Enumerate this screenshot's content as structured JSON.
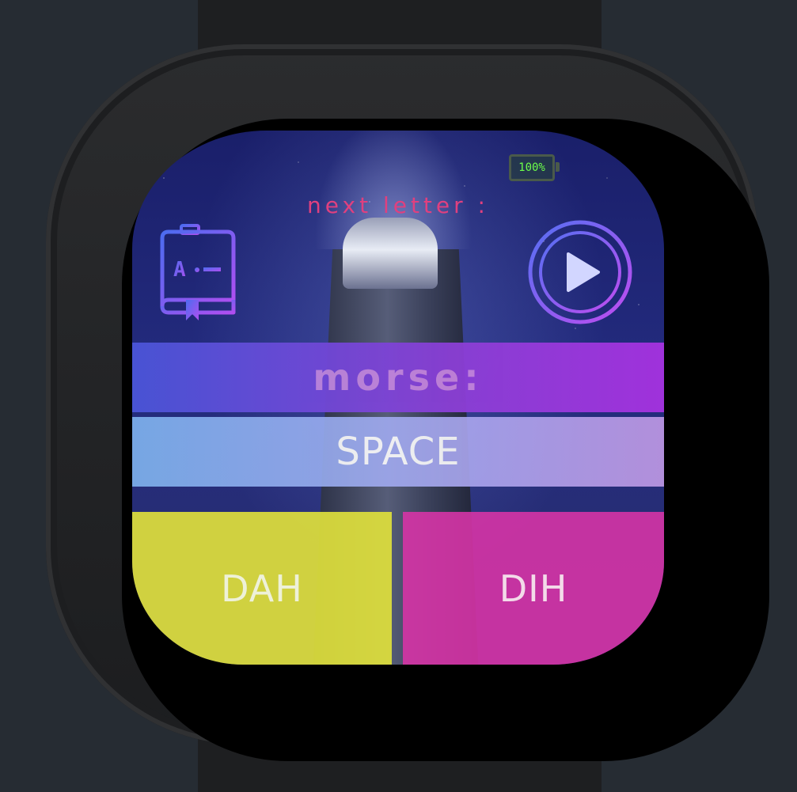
{
  "status": {
    "battery": "100%"
  },
  "header": {
    "next_letter_label": "next letter :"
  },
  "morse": {
    "label": "morse:",
    "current_value": "SPACE"
  },
  "buttons": {
    "dah_label": "DAH",
    "dih_label": "DIH"
  },
  "icons": {
    "dictionary": "dictionary-book-icon",
    "play": "play-icon",
    "battery": "battery-icon"
  },
  "colors": {
    "dah": "#dee03c",
    "dih": "#d634a6",
    "accent_purple": "#a632e0",
    "accent_blue": "#4a55d8",
    "next_letter_text": "#e0407f"
  }
}
